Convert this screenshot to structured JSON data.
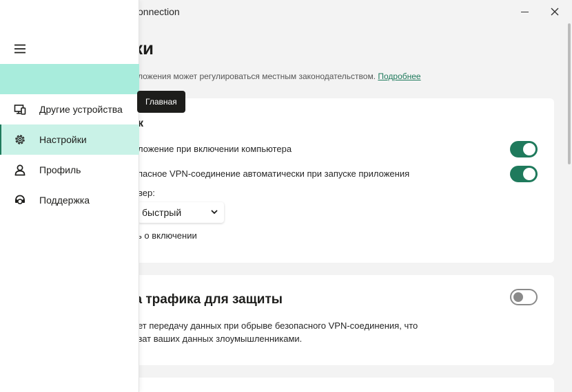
{
  "window": {
    "title": "onnection"
  },
  "main": {
    "page_title": "ки",
    "notice_text": "ложения может регулироваться местным законодательством.",
    "notice_link": "Подробнее",
    "card1": {
      "heading": "к",
      "autostart_text": "ложение при включении компьютера",
      "autoconnect_text": "пасное VPN-соединение автоматически при запуске приложения",
      "server_label": "вер:",
      "server_value": "быстрый",
      "notify_text": "ь о включении",
      "autostart_on": true,
      "autoconnect_on": true
    },
    "card2": {
      "heading": "ка трафика для защиты",
      "line1": "вает передачу данных при обрыве безопасного VPN-соединения, что",
      "line2": "ехват ваших данных злоумышленниками.",
      "toggle_on": false
    }
  },
  "sidebar": {
    "items": [
      {
        "label": "Другие устройства",
        "icon": "devices-icon"
      },
      {
        "label": "Настройки",
        "icon": "gear-icon"
      },
      {
        "label": "Профиль",
        "icon": "user-icon"
      },
      {
        "label": "Поддержка",
        "icon": "support-icon"
      }
    ],
    "tooltip": "Главная"
  },
  "colors": {
    "accent": "#1f7a5c",
    "home_bg": "#a8ecdc",
    "active_bg": "#c9f2e7"
  }
}
